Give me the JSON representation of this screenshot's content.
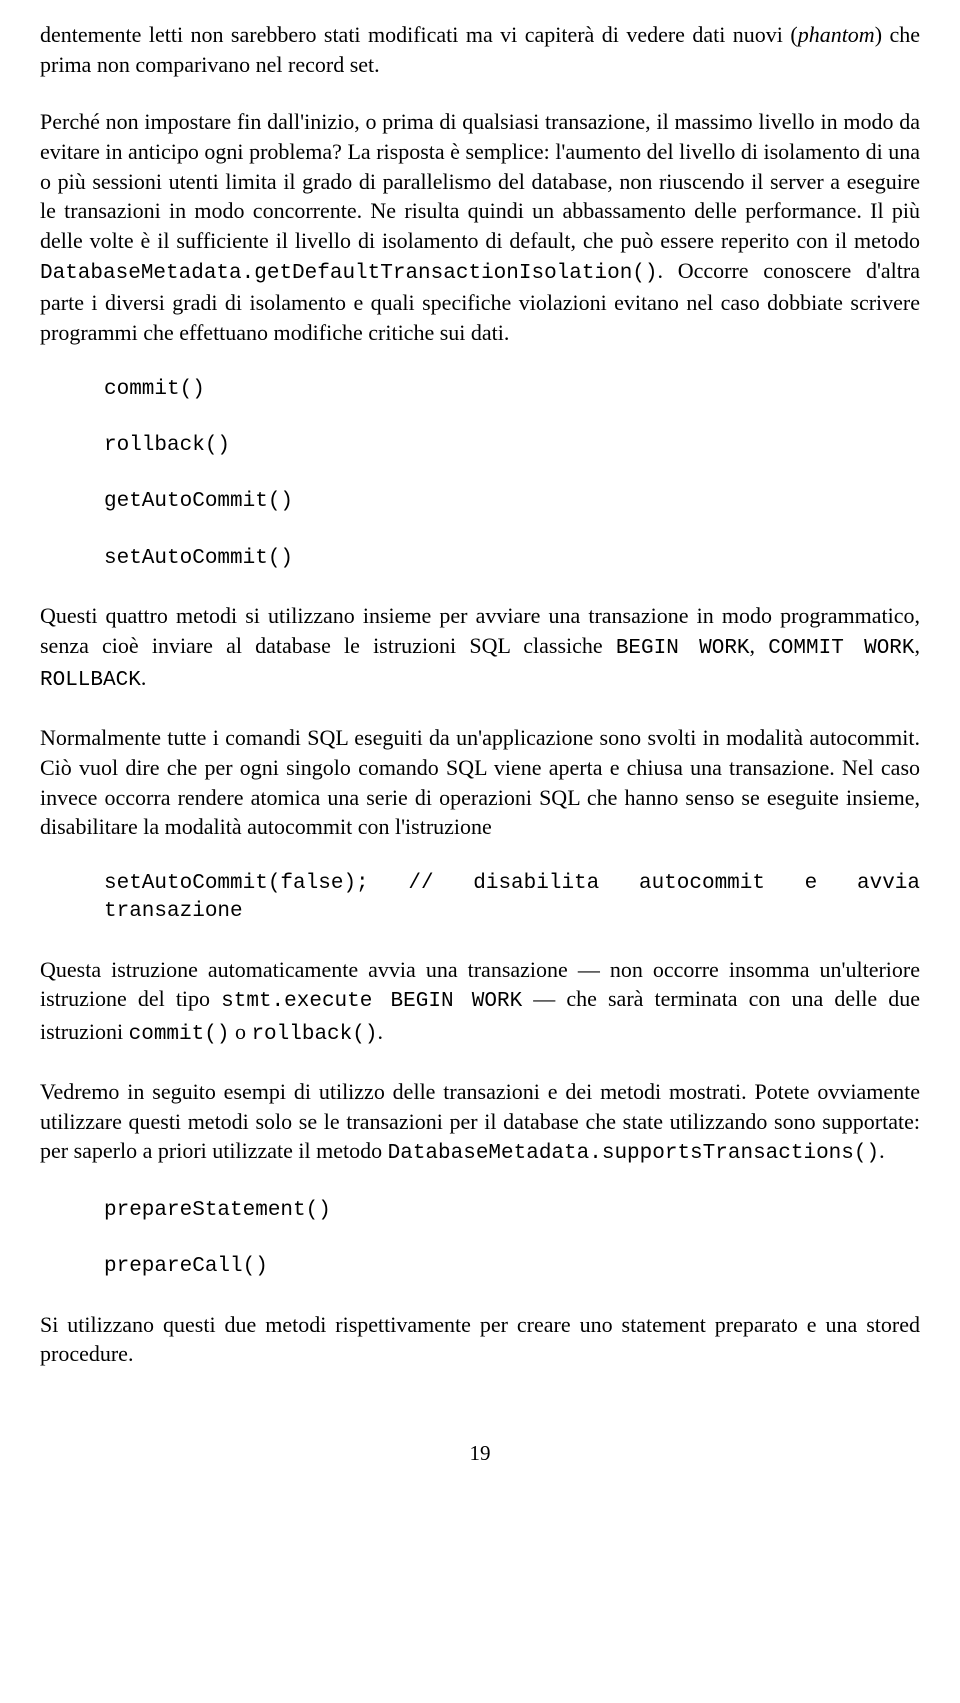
{
  "p1a": "dentemente letti non sarebbero stati modificati ma vi capiterà di vedere dati nuovi (",
  "p1b": "phantom",
  "p1c": ") che prima non comparivano nel record set.",
  "p2a": "Perché non impostare fin dall'inizio, o prima di qualsiasi transazione, il massimo livello in modo da evitare in anticipo ogni problema? La risposta è semplice: l'aumento del livello di isolamento di una o più sessioni utenti limita il grado di parallelismo del database, non riuscendo il server a eseguire le transazioni in modo concorrente. Ne risulta quindi un abbassamento delle performance. Il più delle volte è il sufficiente il livello di isolamento di default, che può essere reperito con il metodo ",
  "p2b": "DatabaseMetadata.getDefaultTransaction­Isolation()",
  "p2c": ". Occorre conoscere d'altra parte i diversi gradi di isolamento e quali specifiche violazioni evitano nel caso dobbiate scrivere programmi che effettuano modifiche critiche sui dati.",
  "codeList1": {
    "c1": "commit()",
    "c2": "rollback()",
    "c3": "getAutoCommit()",
    "c4": "setAutoCommit()"
  },
  "p3a": "Questi quattro metodi si utilizzano insieme per avviare una transazione in modo programmatico, senza cioè inviare al database le istruzioni SQL classiche ",
  "p3b": "BEGIN WORK",
  "p3c": ", ",
  "p3d": "COMMIT WORK",
  "p3e": ", ",
  "p3f": "ROLLBACK",
  "p3g": ".",
  "p4": "Normalmente tutte i comandi SQL eseguiti da un'applicazione sono svolti in modalità autocommit. Ciò vuol dire che per ogni singolo comando SQL viene aperta e chiusa una transazione. Nel caso invece occorra rendere atomica una serie di operazioni SQL che hanno senso se eseguite insieme, disabilitare la modalità autocommit con l'istruzione",
  "codeLine1": "setAutoCommit(false); // disabilita autocommit e avvia transazione",
  "p5a": "Questa istruzione automaticamente avvia una transazione — non occorre insomma un'ulteriore istruzione del tipo ",
  "p5b": "stmt.execute BEGIN WORK",
  "p5c": " — che sarà terminata con una delle due istruzioni ",
  "p5d": "commit()",
  "p5e": " o ",
  "p5f": "rollback()",
  "p5g": ".",
  "p6a": "Vedremo in seguito esempi di utilizzo delle transazioni e dei metodi mostrati. Potete ovviamente utilizzare questi metodi solo se le transazioni per il database che state utilizzando sono supportate: per saperlo a priori utilizzate il metodo ",
  "p6b": "DatabaseMetadata.supports­Transactions()",
  "p6c": ".",
  "codeList2": {
    "c1": "prepareStatement()",
    "c2": "prepareCall()"
  },
  "p7": "Si utilizzano questi due metodi rispettivamente per creare uno statement preparato e una stored procedure.",
  "pageNumber": "19"
}
